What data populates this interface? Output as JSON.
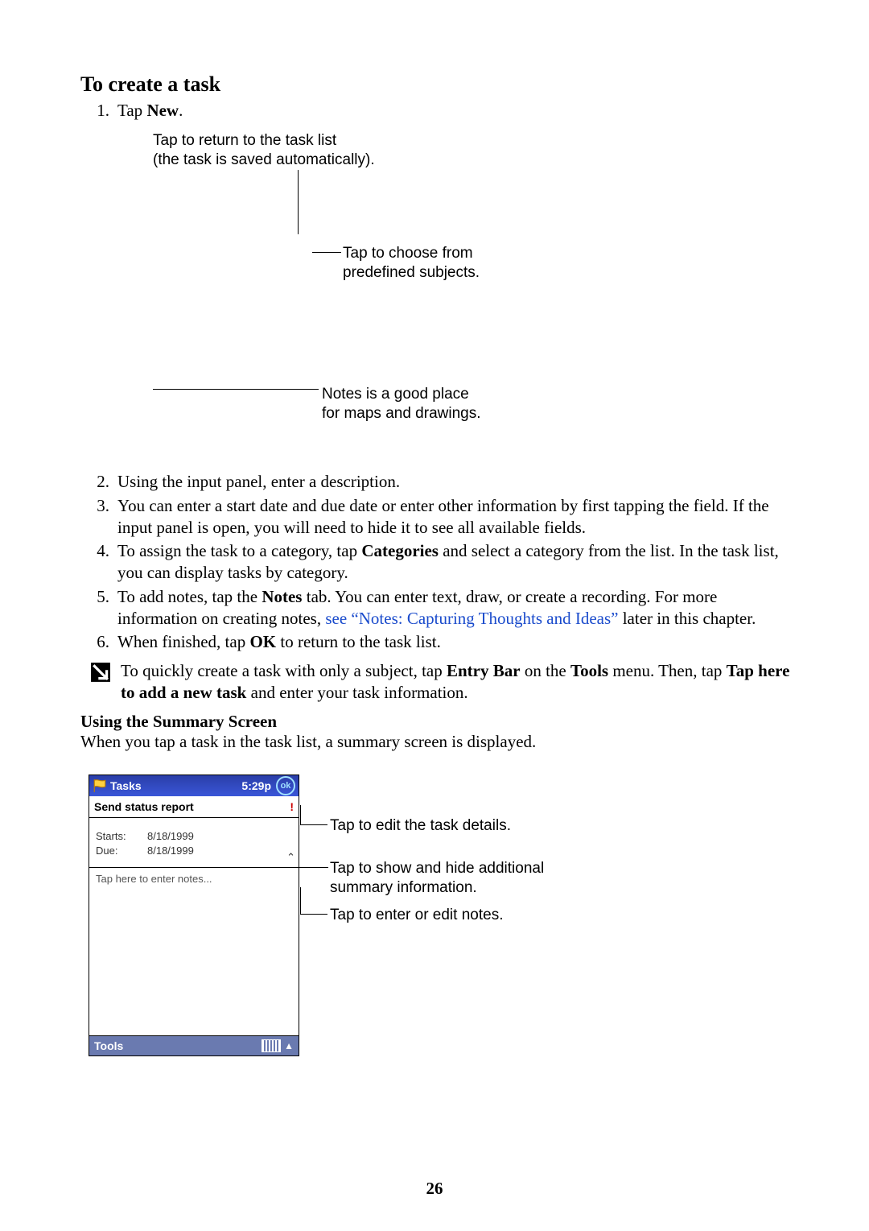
{
  "section_title": "To create a task",
  "steps": {
    "s1_prefix": "Tap ",
    "s1_bold": "New",
    "s1_suffix": ".",
    "s2": "Using the input panel, enter a description.",
    "s3": "You can enter a start date and due date or enter other information by first tapping the field. If the input panel is open, you will need to hide it to see all available fields.",
    "s4_prefix": "To assign the task to a category, tap ",
    "s4_bold": "Categories",
    "s4_suffix": " and select a category from the list. In the task list, you can display tasks by category.",
    "s5_prefix": "To add notes, tap the ",
    "s5_bold": "Notes",
    "s5_mid": " tab. You can enter text, draw, or create a recording. For more information on creating notes, ",
    "s5_link": "see “Notes: Capturing Thoughts and Ideas”",
    "s5_suffix": " later in this chapter.",
    "s6_prefix": "When finished, tap ",
    "s6_bold": "OK",
    "s6_suffix": " to return to the task list."
  },
  "fig1": {
    "ann1_line1": "Tap to return to the task list",
    "ann1_line2": "(the task is saved automatically).",
    "ann2_line1": "Tap to choose from",
    "ann2_line2": "predefined subjects.",
    "ann3_line1": "Notes is a good place",
    "ann3_line2": "for maps and drawings."
  },
  "tip": {
    "t_prefix": "To quickly create a task with only a subject, tap ",
    "t_b1": "Entry Bar",
    "t_mid1": " on the ",
    "t_b2": "Tools",
    "t_mid2": " menu. Then, tap ",
    "t_b3": "Tap here to add a new task",
    "t_suffix": " and enter your task information."
  },
  "subhead": "Using the Summary Screen",
  "summary_intro": "When you tap a task in the task list, a summary screen is displayed.",
  "device": {
    "title": "Tasks",
    "time": "5:29p",
    "ok": "ok",
    "subject": "Send status report",
    "priority_glyph": "!",
    "starts_label": "Starts:",
    "due_label": "Due:",
    "starts_value": "8/18/1999",
    "due_value": "8/18/1999",
    "toggle_glyph": "⌃",
    "notes_placeholder": "Tap here to enter notes...",
    "tools": "Tools",
    "up_glyph": "▲"
  },
  "fig2": {
    "annA": "Tap to edit the task details.",
    "annB_line1": "Tap to show and hide additional",
    "annB_line2": "summary information.",
    "annC": "Tap to enter or edit notes."
  },
  "page_number": "26"
}
